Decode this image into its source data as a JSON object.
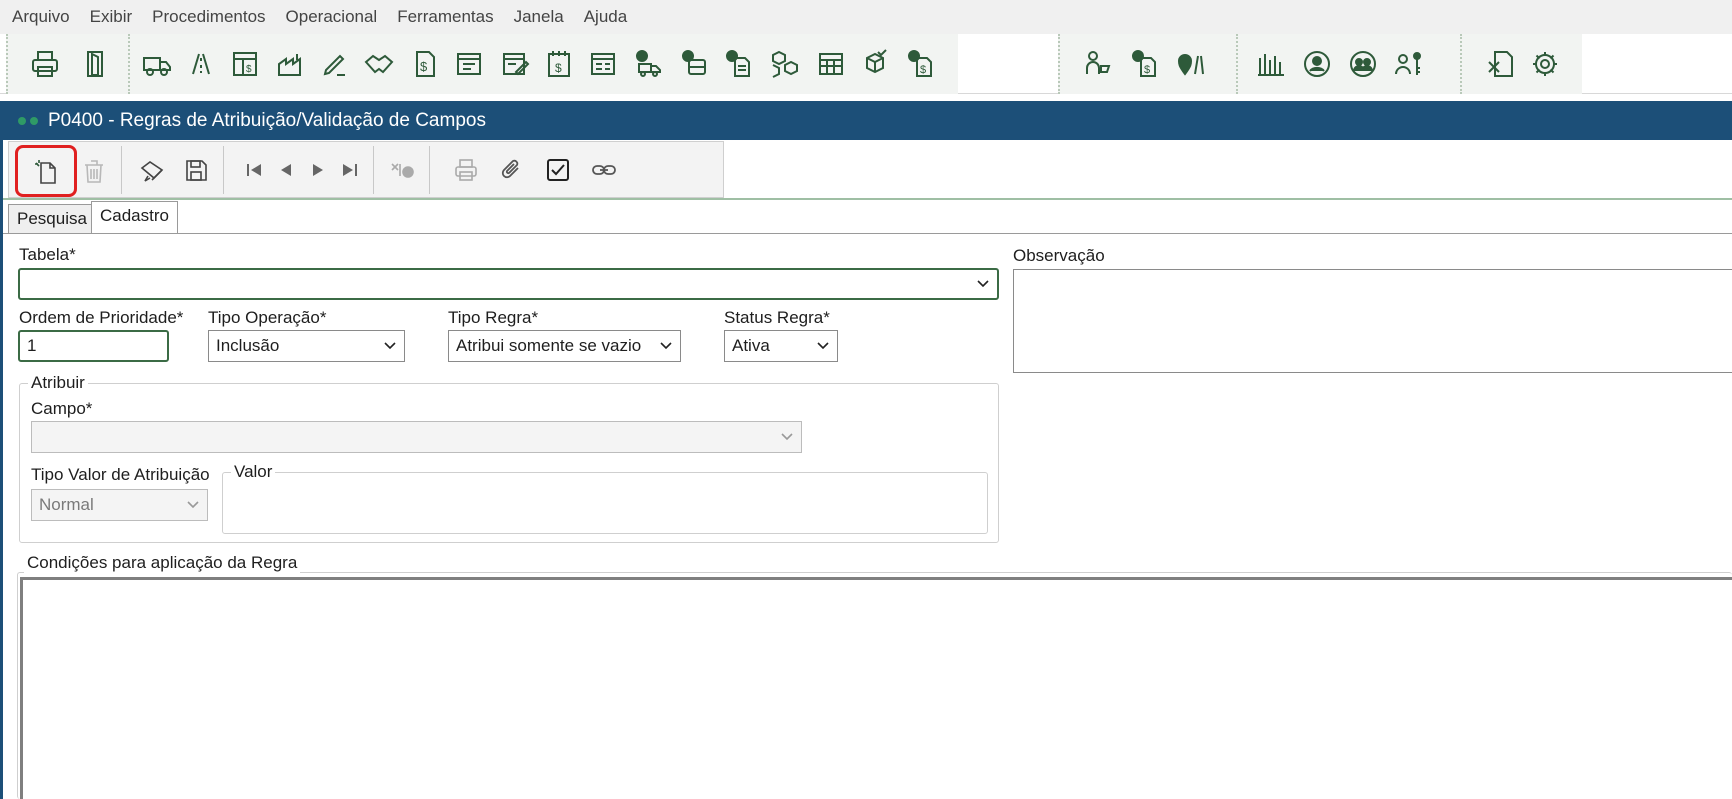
{
  "menu": [
    "Arquivo",
    "Exibir",
    "Procedimentos",
    "Operacional",
    "Ferramentas",
    "Janela",
    "Ajuda"
  ],
  "window": {
    "title": "P0400 - Regras de Atribuição/Validação de Campos"
  },
  "tabs": [
    "Pesquisa",
    "Cadastro"
  ],
  "form": {
    "tabela_label": "Tabela*",
    "tabela_value": "",
    "observacao_label": "Observação",
    "ordem_label": "Ordem de Prioridade*",
    "ordem_value": "1",
    "tipo_operacao_label": "Tipo Operação*",
    "tipo_operacao_value": "Inclusão",
    "tipo_regra_label": "Tipo Regra*",
    "tipo_regra_value": "Atribui somente se vazio",
    "status_label": "Status Regra*",
    "status_value": "Ativa",
    "atribuir_title": "Atribuir",
    "campo_label": "Campo*",
    "campo_value": "",
    "tipo_valor_label": "Tipo Valor de Atribuição",
    "tipo_valor_value": "Normal",
    "valor_title": "Valor",
    "condicoes_title": "Condições para aplicação da Regra"
  },
  "colors": {
    "title_bar": "#1c4f78",
    "icon_green": "#2e5a3a",
    "highlight": "#e02020"
  }
}
